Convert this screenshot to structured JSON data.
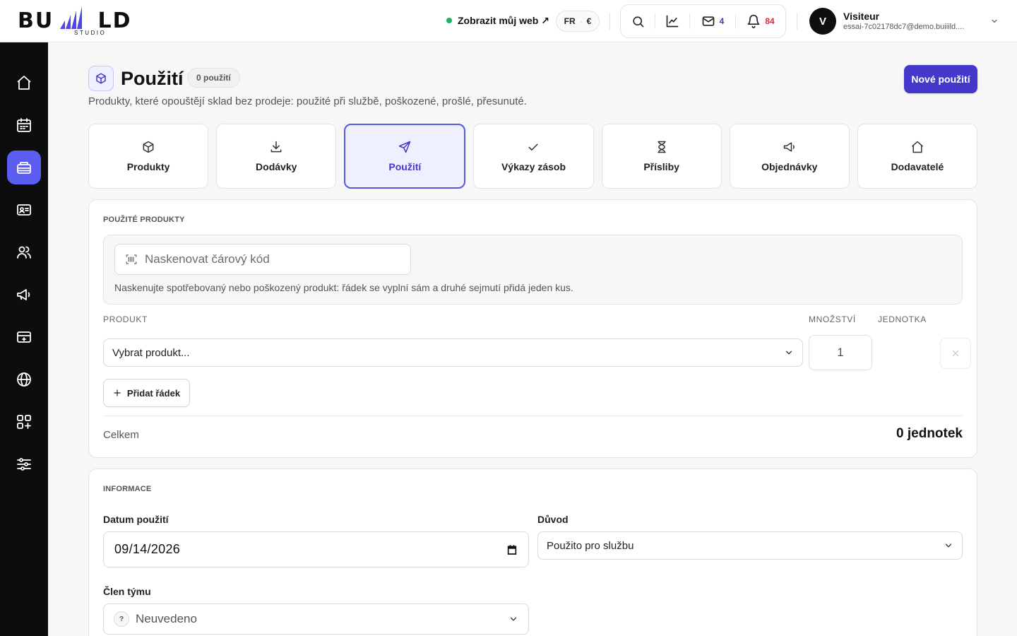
{
  "brand": {
    "logo_text": "BU LD",
    "logo_subtext": "STUDIO"
  },
  "header": {
    "view_site": "Zobrazit můj web ↗",
    "lang": "FR",
    "dot_sep": "·",
    "currency": "€",
    "mail_count": "4",
    "notif_count": "84",
    "user": {
      "initial": "V",
      "name": "Visiteur",
      "email": "essai-7c02178dc7@demo.buiiild...."
    }
  },
  "page": {
    "title": "Použití",
    "badge": "0 použití",
    "subtitle": "Produkty, které opouštějí sklad bez prodeje: použité při službě, poškozené, prošlé, přesunuté.",
    "new_button": "Nové použití"
  },
  "tabs": [
    {
      "label": "Produkty",
      "icon": "box-icon"
    },
    {
      "label": "Dodávky",
      "icon": "download-icon"
    },
    {
      "label": "Použití",
      "icon": "send-icon",
      "active": true
    },
    {
      "label": "Výkazy zásob",
      "icon": "check-icon"
    },
    {
      "label": "Přísliby",
      "icon": "hourglass-icon"
    },
    {
      "label": "Objednávky",
      "icon": "megaphone-icon"
    },
    {
      "label": "Dodavatelé",
      "icon": "home-icon"
    }
  ],
  "products_section": {
    "title": "POUŽITÉ PRODUKTY",
    "scan_placeholder": "Naskenovat čárový kód",
    "scan_help": "Naskenujte spotřebovaný nebo poškozený produkt: řádek se vyplní sám a druhé sejmutí přidá jeden kus.",
    "col_product": "PRODUKT",
    "col_qty": "MNOŽSTVÍ",
    "col_unit": "JEDNOTKA",
    "product_placeholder": "Vybrat produkt...",
    "qty_value": "1",
    "add_row": "Přidat řádek",
    "total_label": "Celkem",
    "total_value": "0 jednotek"
  },
  "info_section": {
    "title": "INFORMACE",
    "date_label": "Datum použití",
    "date_value": "09/14/2026",
    "reason_label": "Důvod",
    "reason_value": "Použito pro službu",
    "team_label": "Člen týmu",
    "team_value": "Neuvedeno",
    "team_icon_glyph": "?"
  },
  "sidebar_icons": [
    "home-icon",
    "calendar-icon",
    "inventory-icon",
    "contact-card-icon",
    "users-icon",
    "megaphone-icon",
    "payment-icon",
    "globe-icon",
    "apps-add-icon",
    "sliders-icon"
  ],
  "colors": {
    "accent": "#4338ca",
    "sidebar_active": "#5b5cf0",
    "sidebar_bg": "#0d0d10",
    "status_green": "#1fb45a",
    "notif_red": "#d12f3a"
  }
}
